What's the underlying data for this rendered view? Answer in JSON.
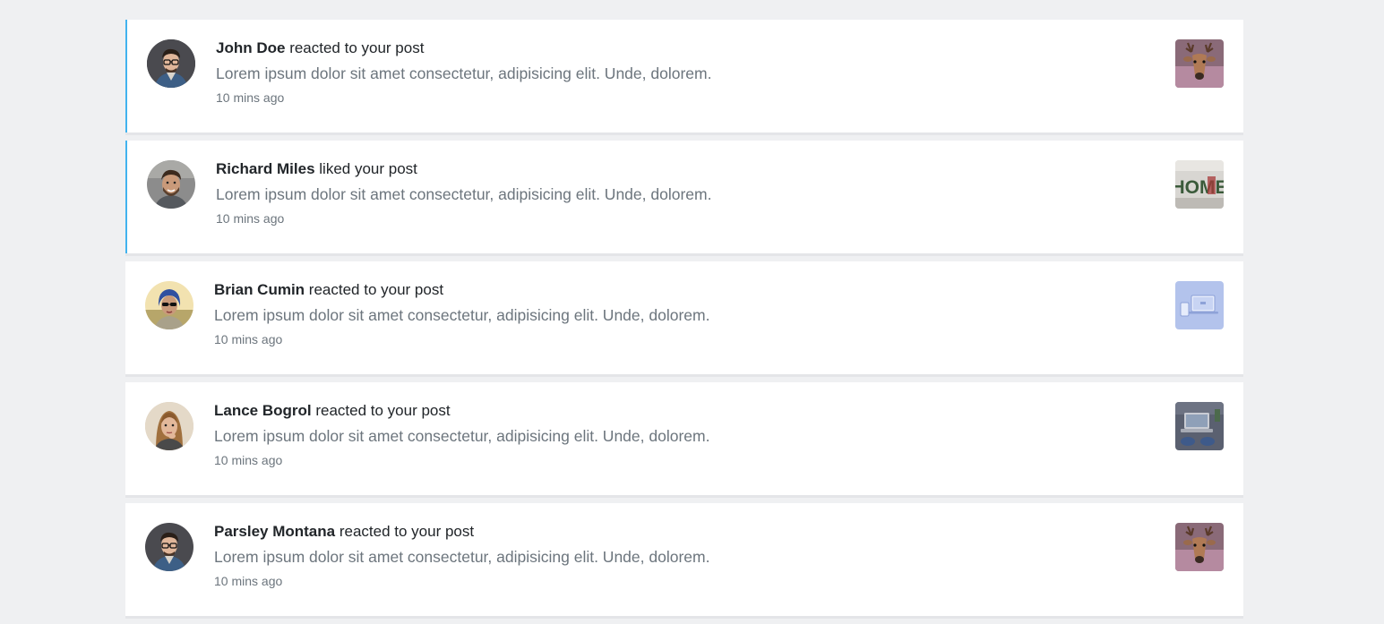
{
  "notifications": [
    {
      "name": "John Doe",
      "action": "reacted to your post",
      "message": "Lorem ipsum dolor sit amet consectetur, adipisicing elit. Unde, dolorem.",
      "time": "10 mins ago",
      "unread": true,
      "avatar_icon": "man-glasses-avatar",
      "thumb_icon": "deer-thumbnail"
    },
    {
      "name": "Richard Miles",
      "action": "liked your post",
      "message": "Lorem ipsum dolor sit amet consectetur, adipisicing elit. Unde, dolorem.",
      "time": "10 mins ago",
      "unread": true,
      "avatar_icon": "smiling-man-avatar",
      "thumb_icon": "home-letters-thumbnail",
      "thumb_text": "HOME"
    },
    {
      "name": "Brian Cumin",
      "action": "reacted to your post",
      "message": "Lorem ipsum dolor sit amet consectetur, adipisicing elit. Unde, dolorem.",
      "time": "10 mins ago",
      "unread": false,
      "avatar_icon": "woman-sunglasses-avatar",
      "thumb_icon": "devices-thumbnail"
    },
    {
      "name": "Lance Bogrol",
      "action": "reacted to your post",
      "message": "Lorem ipsum dolor sit amet consectetur, adipisicing elit. Unde, dolorem.",
      "time": "10 mins ago",
      "unread": false,
      "avatar_icon": "woman-thinking-avatar",
      "thumb_icon": "desk-laptop-thumbnail"
    },
    {
      "name": "Parsley Montana",
      "action": "reacted to your post",
      "message": "Lorem ipsum dolor sit amet consectetur, adipisicing elit. Unde, dolorem.",
      "time": "10 mins ago",
      "unread": false,
      "avatar_icon": "man-glasses-avatar",
      "thumb_icon": "deer-thumbnail"
    }
  ],
  "colors": {
    "background": "#eff0f2",
    "card": "#ffffff",
    "unread_accent": "#42b3ee",
    "name_text": "#212529",
    "muted_text": "#6c757d"
  }
}
